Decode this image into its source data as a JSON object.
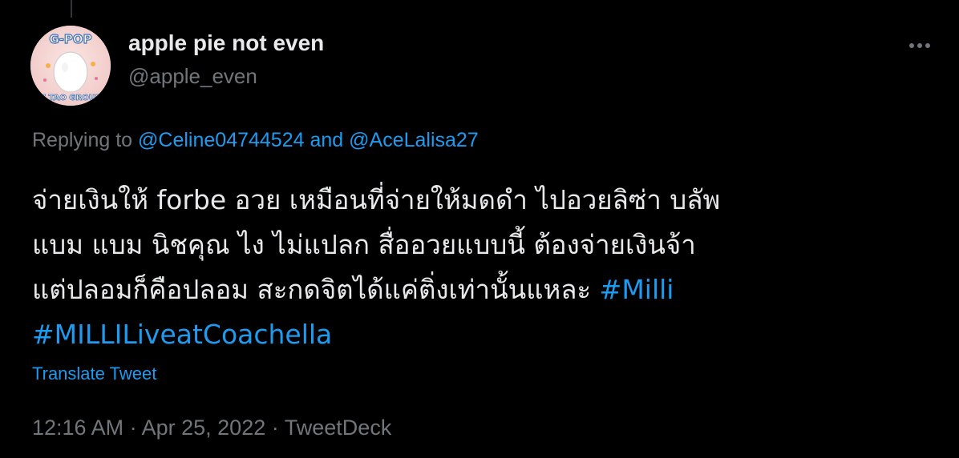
{
  "tweet": {
    "display_name": "apple pie not even",
    "handle": "@apple_even",
    "avatar_text_top": "G-POP",
    "avatar_text_bottom": "Z TAO GROUP",
    "replying_prefix": "Replying to",
    "reply_user_1": "@Celine04744524",
    "reply_and": "and",
    "reply_user_2": "@AceLalisa27",
    "body_line_1": "จ่ายเงินให้ forbe อวย เหมือนที่จ่ายให้มดดำ ไปอวยลิซ่า บลัพ",
    "body_line_2": "แบม แบม นิชคุณ ไง ไม่แปลก สื่ออวยแบบนี้ ต้องจ่ายเงินจ้า",
    "body_line_3": "แต่ปลอมก็คือปลอม สะกดจิตได้แค่ติ่งเท่านั้นแหละ",
    "hashtag_1": "#Milli",
    "hashtag_2": "#MILLILiveatCoachella",
    "translate_label": "Translate Tweet",
    "time": "12:16 AM",
    "separator": "·",
    "date": "Apr 25, 2022",
    "source": "TweetDeck"
  },
  "colors": {
    "background": "#000000",
    "primary_text": "#e7e9ea",
    "secondary_text": "#71767b",
    "accent": "#1d9bf0"
  },
  "icons": {
    "more": "more-horizontal-icon"
  }
}
